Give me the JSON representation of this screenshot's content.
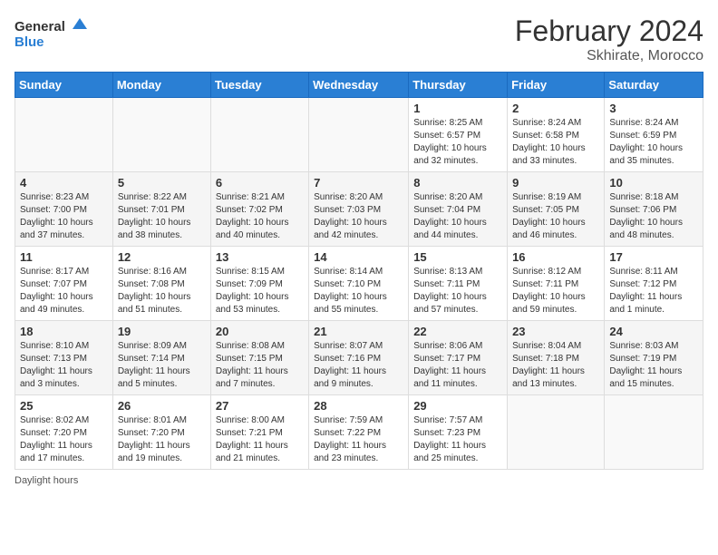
{
  "header": {
    "logo_general": "General",
    "logo_blue": "Blue",
    "month_year": "February 2024",
    "location": "Skhirate, Morocco"
  },
  "days_of_week": [
    "Sunday",
    "Monday",
    "Tuesday",
    "Wednesday",
    "Thursday",
    "Friday",
    "Saturday"
  ],
  "weeks": [
    [
      {
        "day": "",
        "sunrise": "",
        "sunset": "",
        "daylight": ""
      },
      {
        "day": "",
        "sunrise": "",
        "sunset": "",
        "daylight": ""
      },
      {
        "day": "",
        "sunrise": "",
        "sunset": "",
        "daylight": ""
      },
      {
        "day": "",
        "sunrise": "",
        "sunset": "",
        "daylight": ""
      },
      {
        "day": "1",
        "sunrise": "Sunrise: 8:25 AM",
        "sunset": "Sunset: 6:57 PM",
        "daylight": "Daylight: 10 hours and 32 minutes."
      },
      {
        "day": "2",
        "sunrise": "Sunrise: 8:24 AM",
        "sunset": "Sunset: 6:58 PM",
        "daylight": "Daylight: 10 hours and 33 minutes."
      },
      {
        "day": "3",
        "sunrise": "Sunrise: 8:24 AM",
        "sunset": "Sunset: 6:59 PM",
        "daylight": "Daylight: 10 hours and 35 minutes."
      }
    ],
    [
      {
        "day": "4",
        "sunrise": "Sunrise: 8:23 AM",
        "sunset": "Sunset: 7:00 PM",
        "daylight": "Daylight: 10 hours and 37 minutes."
      },
      {
        "day": "5",
        "sunrise": "Sunrise: 8:22 AM",
        "sunset": "Sunset: 7:01 PM",
        "daylight": "Daylight: 10 hours and 38 minutes."
      },
      {
        "day": "6",
        "sunrise": "Sunrise: 8:21 AM",
        "sunset": "Sunset: 7:02 PM",
        "daylight": "Daylight: 10 hours and 40 minutes."
      },
      {
        "day": "7",
        "sunrise": "Sunrise: 8:20 AM",
        "sunset": "Sunset: 7:03 PM",
        "daylight": "Daylight: 10 hours and 42 minutes."
      },
      {
        "day": "8",
        "sunrise": "Sunrise: 8:20 AM",
        "sunset": "Sunset: 7:04 PM",
        "daylight": "Daylight: 10 hours and 44 minutes."
      },
      {
        "day": "9",
        "sunrise": "Sunrise: 8:19 AM",
        "sunset": "Sunset: 7:05 PM",
        "daylight": "Daylight: 10 hours and 46 minutes."
      },
      {
        "day": "10",
        "sunrise": "Sunrise: 8:18 AM",
        "sunset": "Sunset: 7:06 PM",
        "daylight": "Daylight: 10 hours and 48 minutes."
      }
    ],
    [
      {
        "day": "11",
        "sunrise": "Sunrise: 8:17 AM",
        "sunset": "Sunset: 7:07 PM",
        "daylight": "Daylight: 10 hours and 49 minutes."
      },
      {
        "day": "12",
        "sunrise": "Sunrise: 8:16 AM",
        "sunset": "Sunset: 7:08 PM",
        "daylight": "Daylight: 10 hours and 51 minutes."
      },
      {
        "day": "13",
        "sunrise": "Sunrise: 8:15 AM",
        "sunset": "Sunset: 7:09 PM",
        "daylight": "Daylight: 10 hours and 53 minutes."
      },
      {
        "day": "14",
        "sunrise": "Sunrise: 8:14 AM",
        "sunset": "Sunset: 7:10 PM",
        "daylight": "Daylight: 10 hours and 55 minutes."
      },
      {
        "day": "15",
        "sunrise": "Sunrise: 8:13 AM",
        "sunset": "Sunset: 7:11 PM",
        "daylight": "Daylight: 10 hours and 57 minutes."
      },
      {
        "day": "16",
        "sunrise": "Sunrise: 8:12 AM",
        "sunset": "Sunset: 7:11 PM",
        "daylight": "Daylight: 10 hours and 59 minutes."
      },
      {
        "day": "17",
        "sunrise": "Sunrise: 8:11 AM",
        "sunset": "Sunset: 7:12 PM",
        "daylight": "Daylight: 11 hours and 1 minute."
      }
    ],
    [
      {
        "day": "18",
        "sunrise": "Sunrise: 8:10 AM",
        "sunset": "Sunset: 7:13 PM",
        "daylight": "Daylight: 11 hours and 3 minutes."
      },
      {
        "day": "19",
        "sunrise": "Sunrise: 8:09 AM",
        "sunset": "Sunset: 7:14 PM",
        "daylight": "Daylight: 11 hours and 5 minutes."
      },
      {
        "day": "20",
        "sunrise": "Sunrise: 8:08 AM",
        "sunset": "Sunset: 7:15 PM",
        "daylight": "Daylight: 11 hours and 7 minutes."
      },
      {
        "day": "21",
        "sunrise": "Sunrise: 8:07 AM",
        "sunset": "Sunset: 7:16 PM",
        "daylight": "Daylight: 11 hours and 9 minutes."
      },
      {
        "day": "22",
        "sunrise": "Sunrise: 8:06 AM",
        "sunset": "Sunset: 7:17 PM",
        "daylight": "Daylight: 11 hours and 11 minutes."
      },
      {
        "day": "23",
        "sunrise": "Sunrise: 8:04 AM",
        "sunset": "Sunset: 7:18 PM",
        "daylight": "Daylight: 11 hours and 13 minutes."
      },
      {
        "day": "24",
        "sunrise": "Sunrise: 8:03 AM",
        "sunset": "Sunset: 7:19 PM",
        "daylight": "Daylight: 11 hours and 15 minutes."
      }
    ],
    [
      {
        "day": "25",
        "sunrise": "Sunrise: 8:02 AM",
        "sunset": "Sunset: 7:20 PM",
        "daylight": "Daylight: 11 hours and 17 minutes."
      },
      {
        "day": "26",
        "sunrise": "Sunrise: 8:01 AM",
        "sunset": "Sunset: 7:20 PM",
        "daylight": "Daylight: 11 hours and 19 minutes."
      },
      {
        "day": "27",
        "sunrise": "Sunrise: 8:00 AM",
        "sunset": "Sunset: 7:21 PM",
        "daylight": "Daylight: 11 hours and 21 minutes."
      },
      {
        "day": "28",
        "sunrise": "Sunrise: 7:59 AM",
        "sunset": "Sunset: 7:22 PM",
        "daylight": "Daylight: 11 hours and 23 minutes."
      },
      {
        "day": "29",
        "sunrise": "Sunrise: 7:57 AM",
        "sunset": "Sunset: 7:23 PM",
        "daylight": "Daylight: 11 hours and 25 minutes."
      },
      {
        "day": "",
        "sunrise": "",
        "sunset": "",
        "daylight": ""
      },
      {
        "day": "",
        "sunrise": "",
        "sunset": "",
        "daylight": ""
      }
    ]
  ],
  "footer": {
    "daylight_label": "Daylight hours"
  }
}
